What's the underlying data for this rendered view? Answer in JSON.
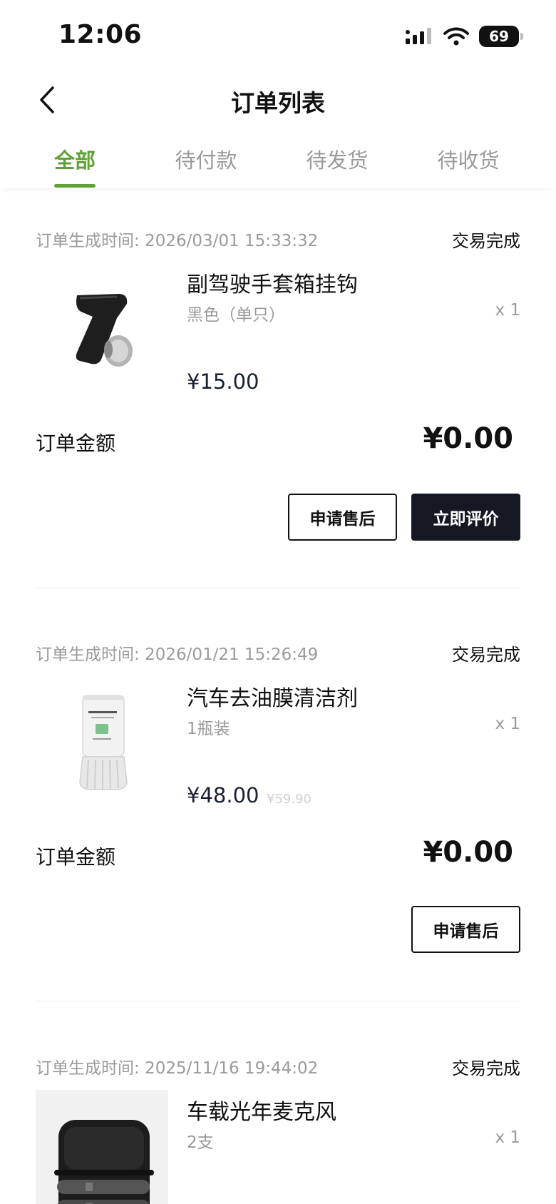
{
  "status_bar": {
    "time": "12:06",
    "battery": "69"
  },
  "nav": {
    "title": "订单列表"
  },
  "tabs": [
    {
      "label": "全部",
      "active": true
    },
    {
      "label": "待付款",
      "active": false
    },
    {
      "label": "待发货",
      "active": false
    },
    {
      "label": "待收货",
      "active": false
    }
  ],
  "colors": {
    "accent": "#5fa037",
    "dark_button": "#151823"
  },
  "orders": [
    {
      "time_label": "订单生成时间: 2026/03/01 15:33:32",
      "status": "交易完成",
      "product": {
        "name": "副驾驶手套箱挂钩",
        "spec": "黑色（单只）",
        "qty": "x 1",
        "price": "¥15.00",
        "old_price": "",
        "icon": "hook-product-image"
      },
      "total_label": "订单金额",
      "total": "¥0.00",
      "buttons": [
        "申请售后",
        "立即评价"
      ]
    },
    {
      "time_label": "订单生成时间: 2026/01/21 15:26:49",
      "status": "交易完成",
      "product": {
        "name": "汽车去油膜清洁剂",
        "spec": "1瓶装",
        "qty": "x 1",
        "price": "¥48.00",
        "old_price": "¥59.90",
        "icon": "cleaner-bottle-image"
      },
      "total_label": "订单金额",
      "total": "¥0.00",
      "buttons": [
        "申请售后"
      ]
    },
    {
      "time_label": "订单生成时间: 2025/11/16 19:44:02",
      "status": "交易完成",
      "product": {
        "name": "车载光年麦克风",
        "spec": "2支",
        "qty": "x 1",
        "icon": "microphone-case-image"
      }
    }
  ]
}
